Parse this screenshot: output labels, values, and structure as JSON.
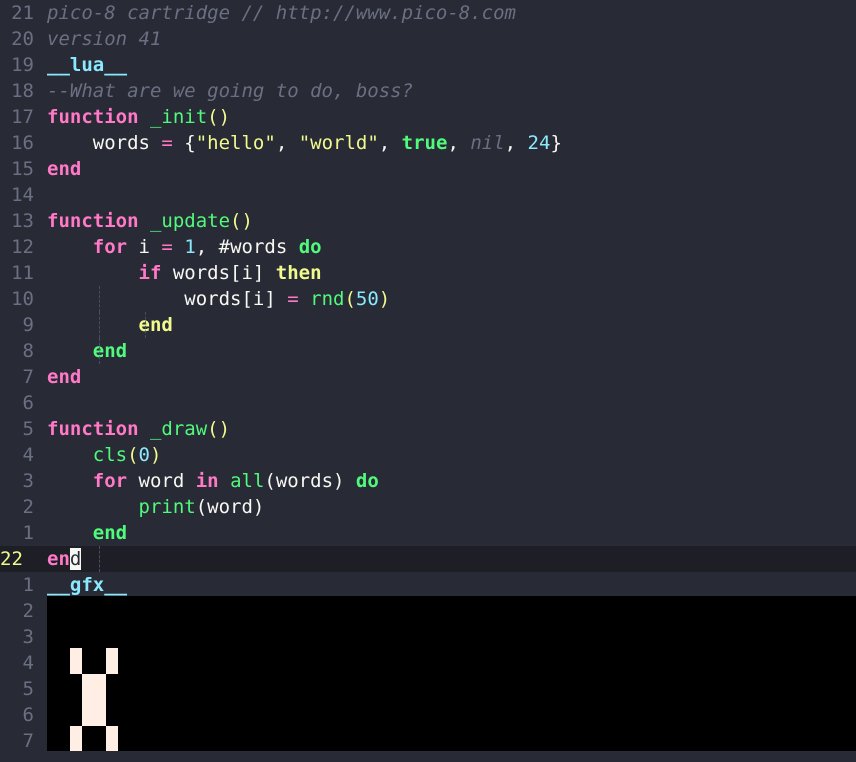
{
  "editor": {
    "lines": [
      {
        "n": "21",
        "tokens": [
          {
            "t": "pico-8 cartridge // http://www.pico-8.com",
            "c": "comment"
          }
        ]
      },
      {
        "n": "20",
        "tokens": [
          {
            "t": "version 41",
            "c": "comment"
          }
        ]
      },
      {
        "n": "19",
        "tokens": [
          {
            "t": "__lua__",
            "c": "tag"
          }
        ]
      },
      {
        "n": "18",
        "tokens": [
          {
            "t": "--What are we going to do, boss?",
            "c": "comment"
          }
        ]
      },
      {
        "n": "17",
        "tokens": [
          {
            "t": "function",
            "c": "k-pink"
          },
          {
            "t": " ",
            "c": "plain"
          },
          {
            "t": "_init",
            "c": "fn"
          },
          {
            "t": "()",
            "c": "str"
          }
        ]
      },
      {
        "n": "16",
        "tokens": [
          {
            "t": "    words ",
            "c": "plain"
          },
          {
            "t": "=",
            "c": "op"
          },
          {
            "t": " {",
            "c": "plain"
          },
          {
            "t": "\"hello\"",
            "c": "str"
          },
          {
            "t": ", ",
            "c": "plain"
          },
          {
            "t": "\"world\"",
            "c": "str"
          },
          {
            "t": ", ",
            "c": "plain"
          },
          {
            "t": "true",
            "c": "k-green"
          },
          {
            "t": ", ",
            "c": "plain"
          },
          {
            "t": "nil",
            "c": "nil"
          },
          {
            "t": ", ",
            "c": "plain"
          },
          {
            "t": "24",
            "c": "num"
          },
          {
            "t": "}",
            "c": "plain"
          }
        ]
      },
      {
        "n": "15",
        "tokens": [
          {
            "t": "end",
            "c": "k-pink"
          }
        ]
      },
      {
        "n": "14",
        "tokens": []
      },
      {
        "n": "13",
        "tokens": [
          {
            "t": "function",
            "c": "k-pink"
          },
          {
            "t": " ",
            "c": "plain"
          },
          {
            "t": "_update",
            "c": "fn"
          },
          {
            "t": "()",
            "c": "str"
          }
        ]
      },
      {
        "n": "12",
        "tokens": [
          {
            "t": "    ",
            "c": "plain"
          },
          {
            "t": "for",
            "c": "k-pink"
          },
          {
            "t": " i ",
            "c": "plain"
          },
          {
            "t": "=",
            "c": "op"
          },
          {
            "t": " ",
            "c": "plain"
          },
          {
            "t": "1",
            "c": "num"
          },
          {
            "t": ", #words ",
            "c": "plain"
          },
          {
            "t": "do",
            "c": "k-green"
          }
        ]
      },
      {
        "n": "11",
        "tokens": [
          {
            "t": "        ",
            "c": "plain"
          },
          {
            "t": "if",
            "c": "k-pink"
          },
          {
            "t": " words[i] ",
            "c": "plain"
          },
          {
            "t": "then",
            "c": "k-yellow"
          }
        ]
      },
      {
        "n": "10",
        "tokens": [
          {
            "t": "            words[i] ",
            "c": "plain"
          },
          {
            "t": "=",
            "c": "op"
          },
          {
            "t": " ",
            "c": "plain"
          },
          {
            "t": "rnd",
            "c": "call"
          },
          {
            "t": "(",
            "c": "str"
          },
          {
            "t": "50",
            "c": "num"
          },
          {
            "t": ")",
            "c": "str"
          }
        ]
      },
      {
        "n": "9",
        "tokens": [
          {
            "t": "        ",
            "c": "plain"
          },
          {
            "t": "end",
            "c": "k-yellow"
          }
        ]
      },
      {
        "n": "8",
        "tokens": [
          {
            "t": "    ",
            "c": "plain"
          },
          {
            "t": "end",
            "c": "k-green"
          }
        ]
      },
      {
        "n": "7",
        "tokens": [
          {
            "t": "end",
            "c": "k-pink"
          }
        ]
      },
      {
        "n": "6",
        "tokens": []
      },
      {
        "n": "5",
        "tokens": [
          {
            "t": "function",
            "c": "k-pink"
          },
          {
            "t": " ",
            "c": "plain"
          },
          {
            "t": "_draw",
            "c": "fn"
          },
          {
            "t": "()",
            "c": "str"
          }
        ]
      },
      {
        "n": "4",
        "tokens": [
          {
            "t": "    ",
            "c": "plain"
          },
          {
            "t": "cls",
            "c": "call"
          },
          {
            "t": "(",
            "c": "str"
          },
          {
            "t": "0",
            "c": "num"
          },
          {
            "t": ")",
            "c": "str"
          }
        ]
      },
      {
        "n": "3",
        "tokens": [
          {
            "t": "    ",
            "c": "plain"
          },
          {
            "t": "for",
            "c": "k-pink"
          },
          {
            "t": " word ",
            "c": "plain"
          },
          {
            "t": "in",
            "c": "k-pink"
          },
          {
            "t": " ",
            "c": "plain"
          },
          {
            "t": "all",
            "c": "call"
          },
          {
            "t": "(words) ",
            "c": "plain"
          },
          {
            "t": "do",
            "c": "k-green"
          }
        ]
      },
      {
        "n": "2",
        "tokens": [
          {
            "t": "        ",
            "c": "plain"
          },
          {
            "t": "print",
            "c": "call"
          },
          {
            "t": "(word)",
            "c": "plain"
          }
        ]
      },
      {
        "n": "1",
        "tokens": [
          {
            "t": "    ",
            "c": "plain"
          },
          {
            "t": "end",
            "c": "k-green"
          }
        ]
      },
      {
        "n": "22",
        "current": true,
        "tokens": [
          {
            "t": "en",
            "c": "k-pink"
          },
          {
            "t": "d",
            "c": "cursor"
          }
        ]
      },
      {
        "n": "1",
        "tokens": [
          {
            "t": "__gfx__",
            "c": "tag"
          }
        ]
      },
      {
        "n": "2",
        "tokens": []
      },
      {
        "n": "3",
        "tokens": []
      },
      {
        "n": "4",
        "tokens": []
      },
      {
        "n": "5",
        "tokens": []
      },
      {
        "n": "6",
        "tokens": []
      },
      {
        "n": "7",
        "tokens": []
      }
    ]
  },
  "gfx": {
    "sprite_color": "#ffeee3",
    "background_color": "#000000"
  }
}
